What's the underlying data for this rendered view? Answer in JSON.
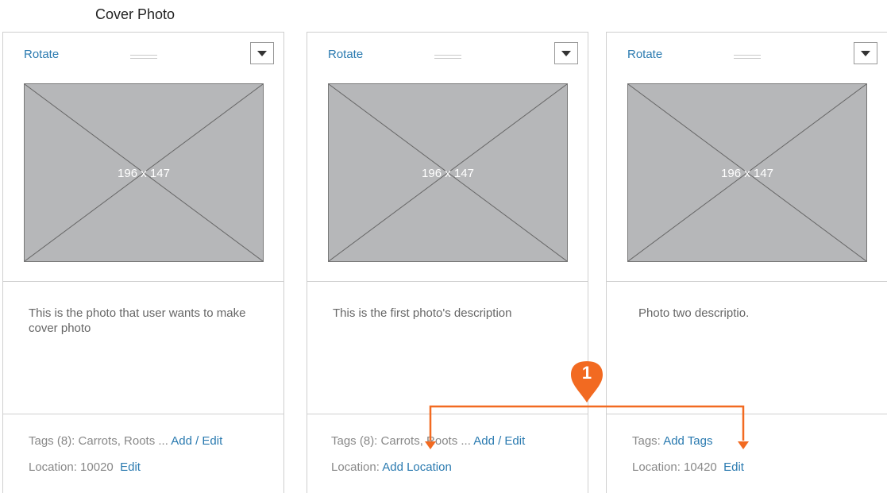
{
  "section_title": "Cover Photo",
  "annotation_number": "1",
  "colors": {
    "link": "#2a7ab0",
    "annotation": "#f26a21",
    "placeholder": "#b6b7b9"
  },
  "cards": [
    {
      "rotate_label": "Rotate",
      "image_dims": "196 x 147",
      "description": "This is the photo that user wants to make cover photo",
      "tags_text": "Tags (8): Carrots, Roots ...",
      "tags_link": "Add / Edit",
      "location_text": "Location: 10020",
      "location_link": "Edit"
    },
    {
      "rotate_label": "Rotate",
      "image_dims": "196 x 147",
      "description": "This is the first photo's description",
      "tags_text": "Tags (8): Carrots, Roots ...",
      "tags_link": "Add / Edit",
      "location_text": "Location:",
      "location_link": "Add Location"
    },
    {
      "rotate_label": "Rotate",
      "image_dims": "196 x 147",
      "description": "Photo two descriptio.",
      "tags_text": "Tags:",
      "tags_link": "Add Tags",
      "location_text": "Location: 10420",
      "location_link": "Edit"
    }
  ]
}
